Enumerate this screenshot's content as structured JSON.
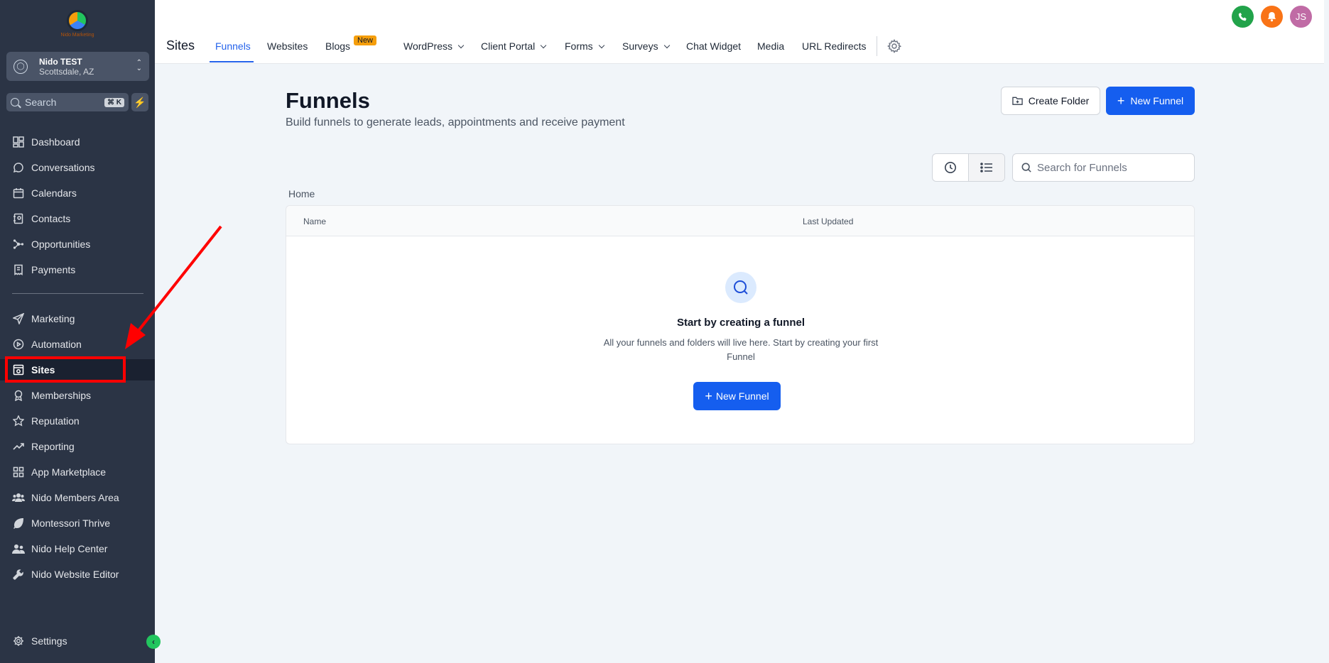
{
  "sidebar": {
    "logo_text": "Nido Marketing",
    "account": {
      "name": "Nido TEST",
      "location": "Scottsdale, AZ"
    },
    "search": {
      "placeholder": "Search",
      "shortcut": "⌘ K"
    },
    "items": [
      {
        "label": "Dashboard",
        "icon": "dashboard-icon"
      },
      {
        "label": "Conversations",
        "icon": "chat-icon"
      },
      {
        "label": "Calendars",
        "icon": "calendar-icon"
      },
      {
        "label": "Contacts",
        "icon": "contacts-icon"
      },
      {
        "label": "Opportunities",
        "icon": "opportunities-icon"
      },
      {
        "label": "Payments",
        "icon": "payments-icon"
      },
      {
        "label": "Marketing",
        "icon": "send-icon"
      },
      {
        "label": "Automation",
        "icon": "automation-icon"
      },
      {
        "label": "Sites",
        "icon": "sites-icon"
      },
      {
        "label": "Memberships",
        "icon": "membership-icon"
      },
      {
        "label": "Reputation",
        "icon": "star-icon"
      },
      {
        "label": "Reporting",
        "icon": "trend-icon"
      },
      {
        "label": "App Marketplace",
        "icon": "grid-icon"
      },
      {
        "label": "Nido Members Area",
        "icon": "users-icon"
      },
      {
        "label": "Montessori Thrive",
        "icon": "leaf-icon"
      },
      {
        "label": "Nido Help Center",
        "icon": "help-icon"
      },
      {
        "label": "Nido Website Editor",
        "icon": "wrench-icon"
      }
    ],
    "settings_label": "Settings",
    "active": "Sites"
  },
  "header": {
    "page_label": "Sites",
    "tabs": [
      {
        "label": "Funnels"
      },
      {
        "label": "Websites"
      },
      {
        "label": "Blogs",
        "badge": "New"
      },
      {
        "label": "WordPress"
      },
      {
        "label": "Client Portal"
      },
      {
        "label": "Forms"
      },
      {
        "label": "Surveys"
      },
      {
        "label": "Chat Widget"
      },
      {
        "label": "Media"
      },
      {
        "label": "URL Redirects"
      }
    ],
    "avatar_initials": "JS"
  },
  "main": {
    "title": "Funnels",
    "subtitle": "Build funnels to generate leads, appointments and receive payment",
    "create_folder_label": "Create Folder",
    "new_funnel_label": "New Funnel",
    "search_placeholder": "Search for Funnels",
    "breadcrumb": "Home",
    "columns": [
      "Name",
      "Last Updated"
    ],
    "empty": {
      "title": "Start by creating a funnel",
      "description": "All your funnels and folders will live here. Start by creating your first Funnel",
      "button_label": "New Funnel"
    }
  },
  "colors": {
    "primary": "#155eef",
    "sidebar": "#2b3445",
    "annotation": "#ff0000"
  }
}
